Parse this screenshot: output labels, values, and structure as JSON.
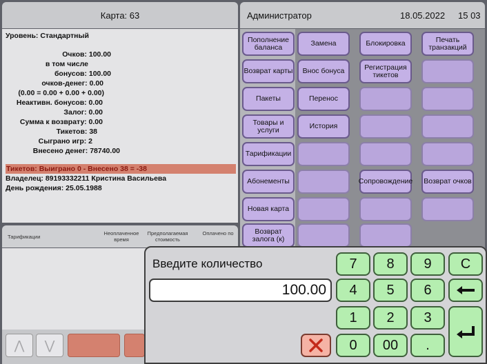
{
  "card": {
    "title": "Карта: 63",
    "level": "Уровень: Стандартный",
    "lines": [
      "Очков: 100.00",
      "в том числе",
      "бонусов: 100.00",
      "очков-денег: 0.00",
      "(0.00 = 0.00 + 0.00 + 0.00)",
      "Неактивн. бонусов: 0.00",
      "Залог: 0.00",
      "Сумма к возврату: 0.00",
      "Тикетов: 38",
      "Сыграно игр: 2",
      "Внесено денег: 78740.00"
    ],
    "tickets_line": "Тикетов: Выиграно 0 - Внесено 38 = -38",
    "owner": "Владелец: 89193332211 Кристина  Васильева",
    "birthday": "День рождения: 25.05.1988"
  },
  "list": {
    "columns": [
      "Тарификации",
      "Неоплаченное время",
      "Предполагаемая стоимость",
      "Оплачено по"
    ]
  },
  "header": {
    "user": "Администратор",
    "date": "18.05.2022",
    "time": "15 03"
  },
  "actions": [
    {
      "label": "Пополнение баланса",
      "enabled": true
    },
    {
      "label": "Замена",
      "enabled": true
    },
    {
      "label": "Блокировка",
      "enabled": true
    },
    {
      "label": "Печать транзакций",
      "enabled": true
    },
    {
      "label": "Возврат карты",
      "enabled": true
    },
    {
      "label": "Внос бонуса",
      "enabled": true
    },
    {
      "label": "Регистрация тикетов",
      "enabled": true
    },
    {
      "label": "",
      "enabled": false
    },
    {
      "label": "Пакеты",
      "enabled": true
    },
    {
      "label": "Перенос",
      "enabled": true
    },
    {
      "label": "",
      "enabled": false
    },
    {
      "label": "",
      "enabled": false
    },
    {
      "label": "Товары и услуги",
      "enabled": true
    },
    {
      "label": "История",
      "enabled": true
    },
    {
      "label": "",
      "enabled": false
    },
    {
      "label": "",
      "enabled": false
    },
    {
      "label": "Тарификации",
      "enabled": true
    },
    {
      "label": "",
      "enabled": false
    },
    {
      "label": "",
      "enabled": false
    },
    {
      "label": "",
      "enabled": false
    },
    {
      "label": "Абонементы",
      "enabled": true
    },
    {
      "label": "",
      "enabled": false
    },
    {
      "label": "Сопровождение",
      "enabled": true
    },
    {
      "label": "Возврат очков",
      "enabled": true
    },
    {
      "label": "Новая карта",
      "enabled": true
    },
    {
      "label": "",
      "enabled": false
    },
    {
      "label": "",
      "enabled": false
    },
    {
      "label": "",
      "enabled": false
    },
    {
      "label": "Возврат залога (к)",
      "enabled": true
    },
    {
      "label": "",
      "enabled": false
    },
    {
      "label": "",
      "enabled": false
    }
  ],
  "dialog": {
    "title": "Введите количество",
    "value": "100.00",
    "keys": [
      "7",
      "8",
      "9",
      "C",
      "4",
      "5",
      "6",
      "1",
      "2",
      "3",
      "0",
      "00",
      "."
    ]
  }
}
